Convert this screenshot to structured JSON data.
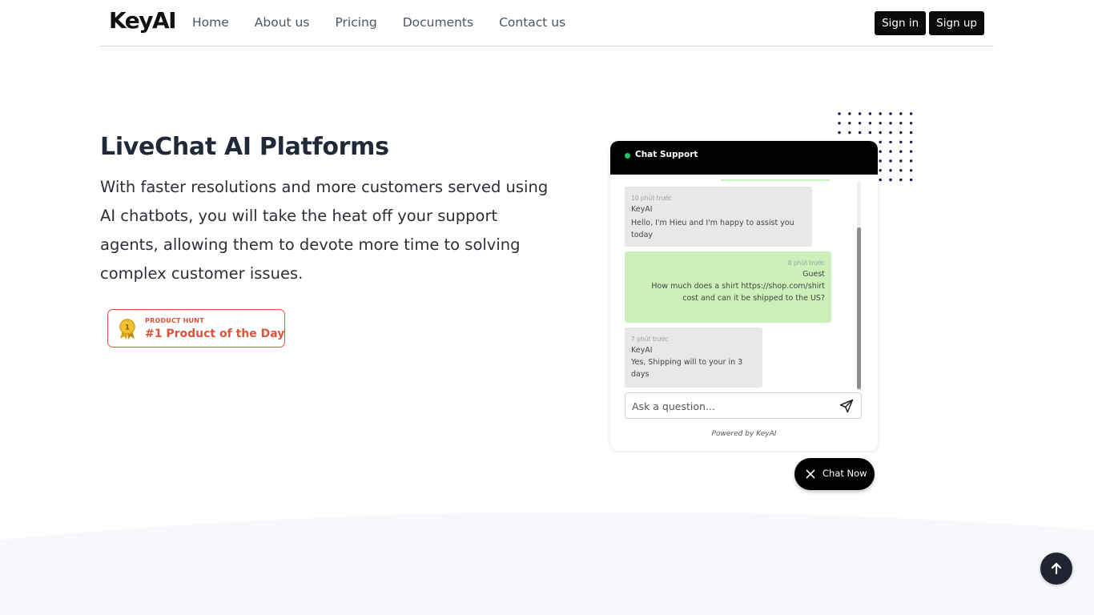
{
  "nav": {
    "logo": "KeyAI",
    "links": [
      "Home",
      "About us",
      "Pricing",
      "Documents",
      "Contact us"
    ],
    "sign_in": "Sign in",
    "sign_up": "Sign up"
  },
  "hero": {
    "title": "LiveChat AI Platforms",
    "description": "With faster resolutions and more customers served using AI chatbots, you will take the heat off your support agents, allowing them to devote more time to solving complex customer issues."
  },
  "badge": {
    "small": "PRODUCT HUNT",
    "big": "#1 Product of the Day",
    "medal_number": "1",
    "accent": "#e0533a"
  },
  "chat": {
    "title": "Chat Support",
    "messages": [
      {
        "time": "10 phút trước",
        "sender": "KeyAI",
        "text": "Hello, I'm Hieu and I'm happy to assist you today"
      },
      {
        "time": "8 phút trước",
        "sender": "Guest",
        "text": "How much does a shirt https://shop.com/shirt cost and can it be shipped to the US?"
      },
      {
        "time": "7 phút trước",
        "sender": "KeyAI",
        "text": "Yes, Shipping will to your in 3 days"
      }
    ],
    "input_placeholder": "Ask a question...",
    "powered": "Powered by KeyAI",
    "chat_now": "Chat Now"
  },
  "colors": {
    "header": "#000000",
    "user_bubble": "#ccf0b8",
    "bot_bubble": "#e8e8e8",
    "online": "#22c55e",
    "dots": "#1e1b4b"
  },
  "icons": [
    "send-icon",
    "close-icon",
    "arrow-up-icon",
    "medal-icon"
  ]
}
